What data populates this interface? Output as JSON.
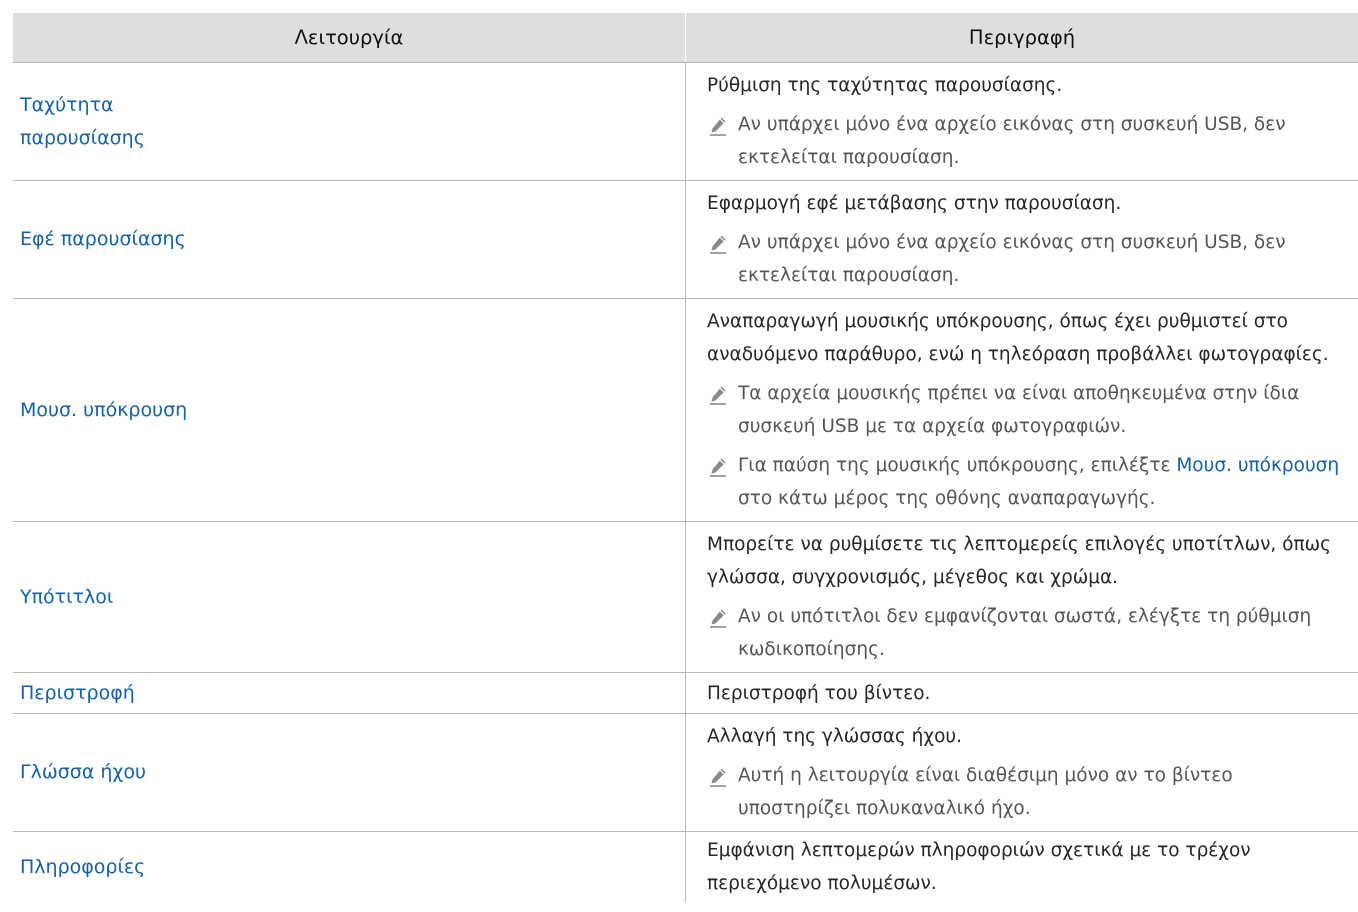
{
  "header": {
    "col1": "Λειτουργία",
    "col2": "Περιγραφή"
  },
  "note_icon": "pencil-icon",
  "rows": [
    {
      "function": "Ταχύτητα παρουσίασης",
      "description": "Ρύθμιση της ταχύτητας παρουσίασης.",
      "notes": [
        "Αν υπάρχει μόνο ένα αρχείο εικόνας στη συσκευή USB, δεν εκτελείται παρουσίαση."
      ]
    },
    {
      "function": "Εφέ παρουσίασης",
      "description": "Εφαρμογή εφέ μετάβασης στην παρουσίαση.",
      "notes": [
        "Αν υπάρχει μόνο ένα αρχείο εικόνας στη συσκευή USB, δεν εκτελείται παρουσίαση."
      ]
    },
    {
      "function": "Μουσ. υπόκρουση",
      "description": "Αναπαραγωγή μουσικής υπόκρουσης, όπως έχει ρυθμιστεί στο αναδυόμενο παράθυρο, ενώ η τηλεόραση προβάλλει φωτογραφίες.",
      "notes": [
        "Τα αρχεία μουσικής πρέπει να είναι αποθηκευμένα στην ίδια συσκευή USB με τα αρχεία φωτογραφιών.",
        {
          "before": "Για παύση της μουσικής υπόκρουσης, επιλέξτε ",
          "highlight": "Μουσ. υπόκρουση",
          "after": " στο κάτω μέρος της οθόνης αναπαραγωγής."
        }
      ]
    },
    {
      "function": "Υπότιτλοι",
      "description": "Μπορείτε να ρυθμίσετε τις λεπτομερείς επιλογές υποτίτλων, όπως γλώσσα, συγχρονισμός, μέγεθος και χρώμα.",
      "notes": [
        "Αν οι υπότιτλοι δεν εμφανίζονται σωστά, ελέγξτε τη ρύθμιση κωδικοποίησης."
      ]
    },
    {
      "function": "Περιστροφή",
      "description": "Περιστροφή του βίντεο.",
      "notes": []
    },
    {
      "function": "Γλώσσα ήχου",
      "description": "Αλλαγή της γλώσσας ήχου.",
      "notes": [
        "Αυτή η λειτουργία είναι διαθέσιμη μόνο αν το βίντεο υποστηρίζει πολυκαναλικό ήχο."
      ]
    },
    {
      "function": "Πληροφορίες",
      "description": "Εμφάνιση λεπτομερών πληροφοριών σχετικά με το τρέχον περιεχόμενο πολυμέσων.",
      "notes": []
    }
  ]
}
